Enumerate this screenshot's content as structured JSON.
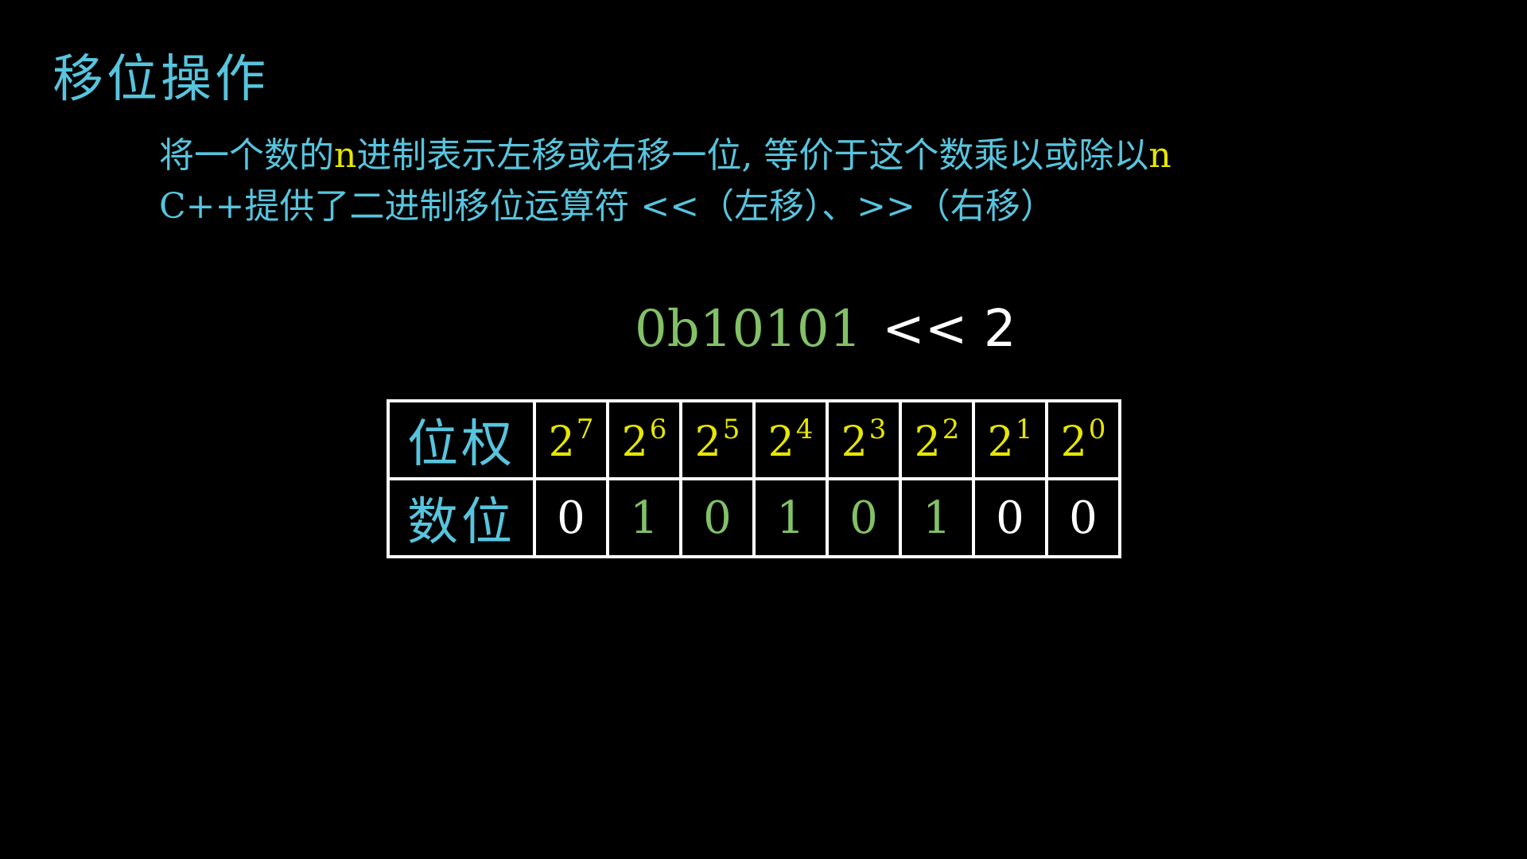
{
  "title": "移位操作",
  "description": {
    "line1": [
      {
        "text": "将一个数的",
        "highlight": false
      },
      {
        "text": "n",
        "highlight": true
      },
      {
        "text": "进制表示左移或右移一位, 等价于这个数乘以或除以",
        "highlight": false
      },
      {
        "text": "n",
        "highlight": true
      }
    ],
    "line2": "C++提供了二进制移位运算符 <<（左移）、>>（右移）"
  },
  "expression": {
    "number": "0b10101",
    "operator": "<< 2"
  },
  "table": {
    "row1_header": "位权",
    "row2_header": "数位",
    "base": "2",
    "exponents": [
      "7",
      "6",
      "5",
      "4",
      "3",
      "2",
      "1",
      "0"
    ],
    "digits": [
      {
        "value": "0",
        "color": "#ffffff"
      },
      {
        "value": "1",
        "color": "#83c167"
      },
      {
        "value": "0",
        "color": "#83c167"
      },
      {
        "value": "1",
        "color": "#83c167"
      },
      {
        "value": "0",
        "color": "#83c167"
      },
      {
        "value": "1",
        "color": "#83c167"
      },
      {
        "value": "0",
        "color": "#ffffff"
      },
      {
        "value": "0",
        "color": "#ffffff"
      }
    ]
  },
  "colors": {
    "background": "#000000",
    "blue": "#58c4dd",
    "yellow": "#e6e600",
    "green": "#83c167",
    "white": "#ffffff"
  }
}
